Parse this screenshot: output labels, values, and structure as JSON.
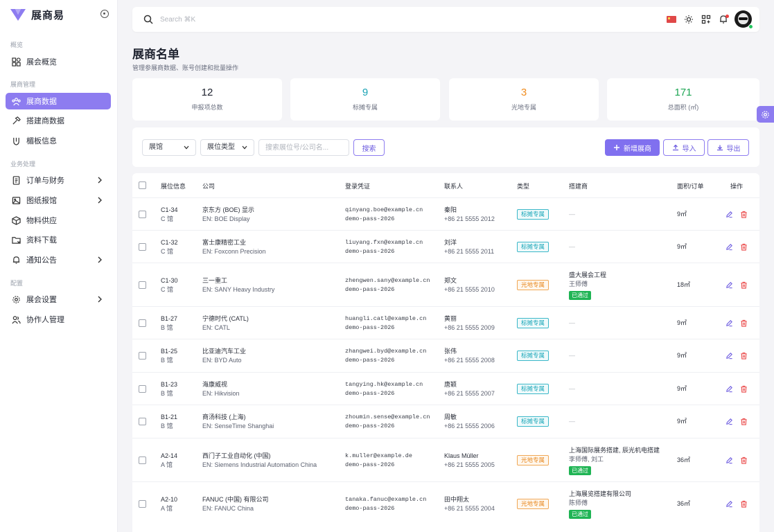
{
  "brand": {
    "name": "展商易"
  },
  "sidebar": {
    "sections": [
      "概览",
      "展商管理",
      "业务处理",
      "配置"
    ],
    "items": [
      {
        "label": "展会概览",
        "icon": "grid-icon"
      },
      {
        "label": "展商数据",
        "icon": "users-icon",
        "active": true
      },
      {
        "label": "搭建商数据",
        "icon": "hammer-icon"
      },
      {
        "label": "楣板信息",
        "icon": "shield-icon"
      },
      {
        "label": "订单与财务",
        "icon": "receipt-icon",
        "expandable": true
      },
      {
        "label": "图纸报馆",
        "icon": "image-icon",
        "expandable": true
      },
      {
        "label": "物料供应",
        "icon": "box-icon"
      },
      {
        "label": "资料下载",
        "icon": "folder-icon"
      },
      {
        "label": "通知公告",
        "icon": "bell-icon",
        "expandable": true
      },
      {
        "label": "展会设置",
        "icon": "gear-icon",
        "expandable": true
      },
      {
        "label": "协作人管理",
        "icon": "people-icon"
      }
    ]
  },
  "topbar": {
    "search_placeholder": "Search ⌘K"
  },
  "page": {
    "title": "展商名单",
    "subtitle": "管理参展商数据、账号创建和批量操作"
  },
  "stats": [
    {
      "value": "12",
      "label": "申报项总数",
      "color": "#1f2330"
    },
    {
      "value": "9",
      "label": "标摊专属",
      "color": "#1aa3b5"
    },
    {
      "value": "3",
      "label": "光地专属",
      "color": "#f08c1e"
    },
    {
      "value": "171",
      "label": "总面积 (㎡)",
      "color": "#1fa655"
    }
  ],
  "filters": {
    "hall_select": "展馆",
    "type_select": "展位类型",
    "keyword_placeholder": "搜索展位号/公司名...",
    "search_button": "搜索",
    "add_button": "新增展商",
    "import_button": "导入",
    "export_button": "导出"
  },
  "table": {
    "headers": [
      "展位信息",
      "公司",
      "登录凭证",
      "联系人",
      "类型",
      "搭建商",
      "面积/订单",
      "操作"
    ],
    "rows": [
      {
        "booth": "C1-34",
        "hall": "C 馆",
        "company": "京东方 (BOE) 显示",
        "company_en": "EN: BOE Display",
        "email": "qinyang.boe@example.cn",
        "pass": "demo-pass-2026",
        "contact": "秦阳",
        "phone": "+86 21 5555 2012",
        "type": "标摊专属",
        "kind": "booth",
        "builder": "—",
        "area": "9㎡"
      },
      {
        "booth": "C1-32",
        "hall": "C 馆",
        "company": "富士康精密工业",
        "company_en": "EN: Foxconn Precision",
        "email": "liuyang.fxn@example.cn",
        "pass": "demo-pass-2026",
        "contact": "刘洋",
        "phone": "+86 21 5555 2011",
        "type": "标摊专属",
        "kind": "booth",
        "builder": "—",
        "area": "9㎡"
      },
      {
        "booth": "C1-30",
        "hall": "C 馆",
        "company": "三一重工",
        "company_en": "EN: SANY Heavy Industry",
        "email": "zhengwen.sany@example.cn",
        "pass": "demo-pass-2026",
        "contact": "郑文",
        "phone": "+86 21 5555 2010",
        "type": "光地专属",
        "kind": "space",
        "builder": "盛大展会工程",
        "builder_contact": "王师傅",
        "builder_status": "已通过",
        "area": "18㎡"
      },
      {
        "booth": "B1-27",
        "hall": "B 馆",
        "company": "宁德时代 (CATL)",
        "company_en": "EN: CATL",
        "email": "huangli.catl@example.cn",
        "pass": "demo-pass-2026",
        "contact": "黄丽",
        "phone": "+86 21 5555 2009",
        "type": "标摊专属",
        "kind": "booth",
        "builder": "—",
        "area": "9㎡"
      },
      {
        "booth": "B1-25",
        "hall": "B 馆",
        "company": "比亚迪汽车工业",
        "company_en": "EN: BYD Auto",
        "email": "zhangwei.byd@example.cn",
        "pass": "demo-pass-2026",
        "contact": "张伟",
        "phone": "+86 21 5555 2008",
        "type": "标摊专属",
        "kind": "booth",
        "builder": "—",
        "area": "9㎡"
      },
      {
        "booth": "B1-23",
        "hall": "B 馆",
        "company": "海康威视",
        "company_en": "EN: Hikvision",
        "email": "tangying.hk@example.cn",
        "pass": "demo-pass-2026",
        "contact": "唐颖",
        "phone": "+86 21 5555 2007",
        "type": "标摊专属",
        "kind": "booth",
        "builder": "—",
        "area": "9㎡"
      },
      {
        "booth": "B1-21",
        "hall": "B 馆",
        "company": "商汤科技 (上海)",
        "company_en": "EN: SenseTime Shanghai",
        "email": "zhoumin.sense@example.cn",
        "pass": "demo-pass-2026",
        "contact": "周敏",
        "phone": "+86 21 5555 2006",
        "type": "标摊专属",
        "kind": "booth",
        "builder": "—",
        "area": "9㎡"
      },
      {
        "booth": "A2-14",
        "hall": "A 馆",
        "company": "西门子工业自动化 (中国)",
        "company_en": "EN: Siemens Industrial Automation China",
        "email": "k.muller@example.de",
        "pass": "demo-pass-2026",
        "contact": "Klaus Müller",
        "phone": "+86 21 5555 2005",
        "type": "光地专属",
        "kind": "space",
        "builder": "上海国际展务搭建, 辰光机电搭建",
        "builder_contact": "李师傅, 刘工",
        "builder_status": "已通过",
        "area": "36㎡"
      },
      {
        "booth": "A2-10",
        "hall": "A 馆",
        "company": "FANUC (中国) 有限公司",
        "company_en": "EN: FANUC China",
        "email": "tanaka.fanuc@example.cn",
        "pass": "demo-pass-2026",
        "contact": "田中翔太",
        "phone": "+86 21 5555 2004",
        "type": "光地专属",
        "kind": "space",
        "builder": "上海展览搭建有限公司",
        "builder_contact": "陈师傅",
        "builder_status": "已通过",
        "area": "36㎡"
      }
    ]
  }
}
